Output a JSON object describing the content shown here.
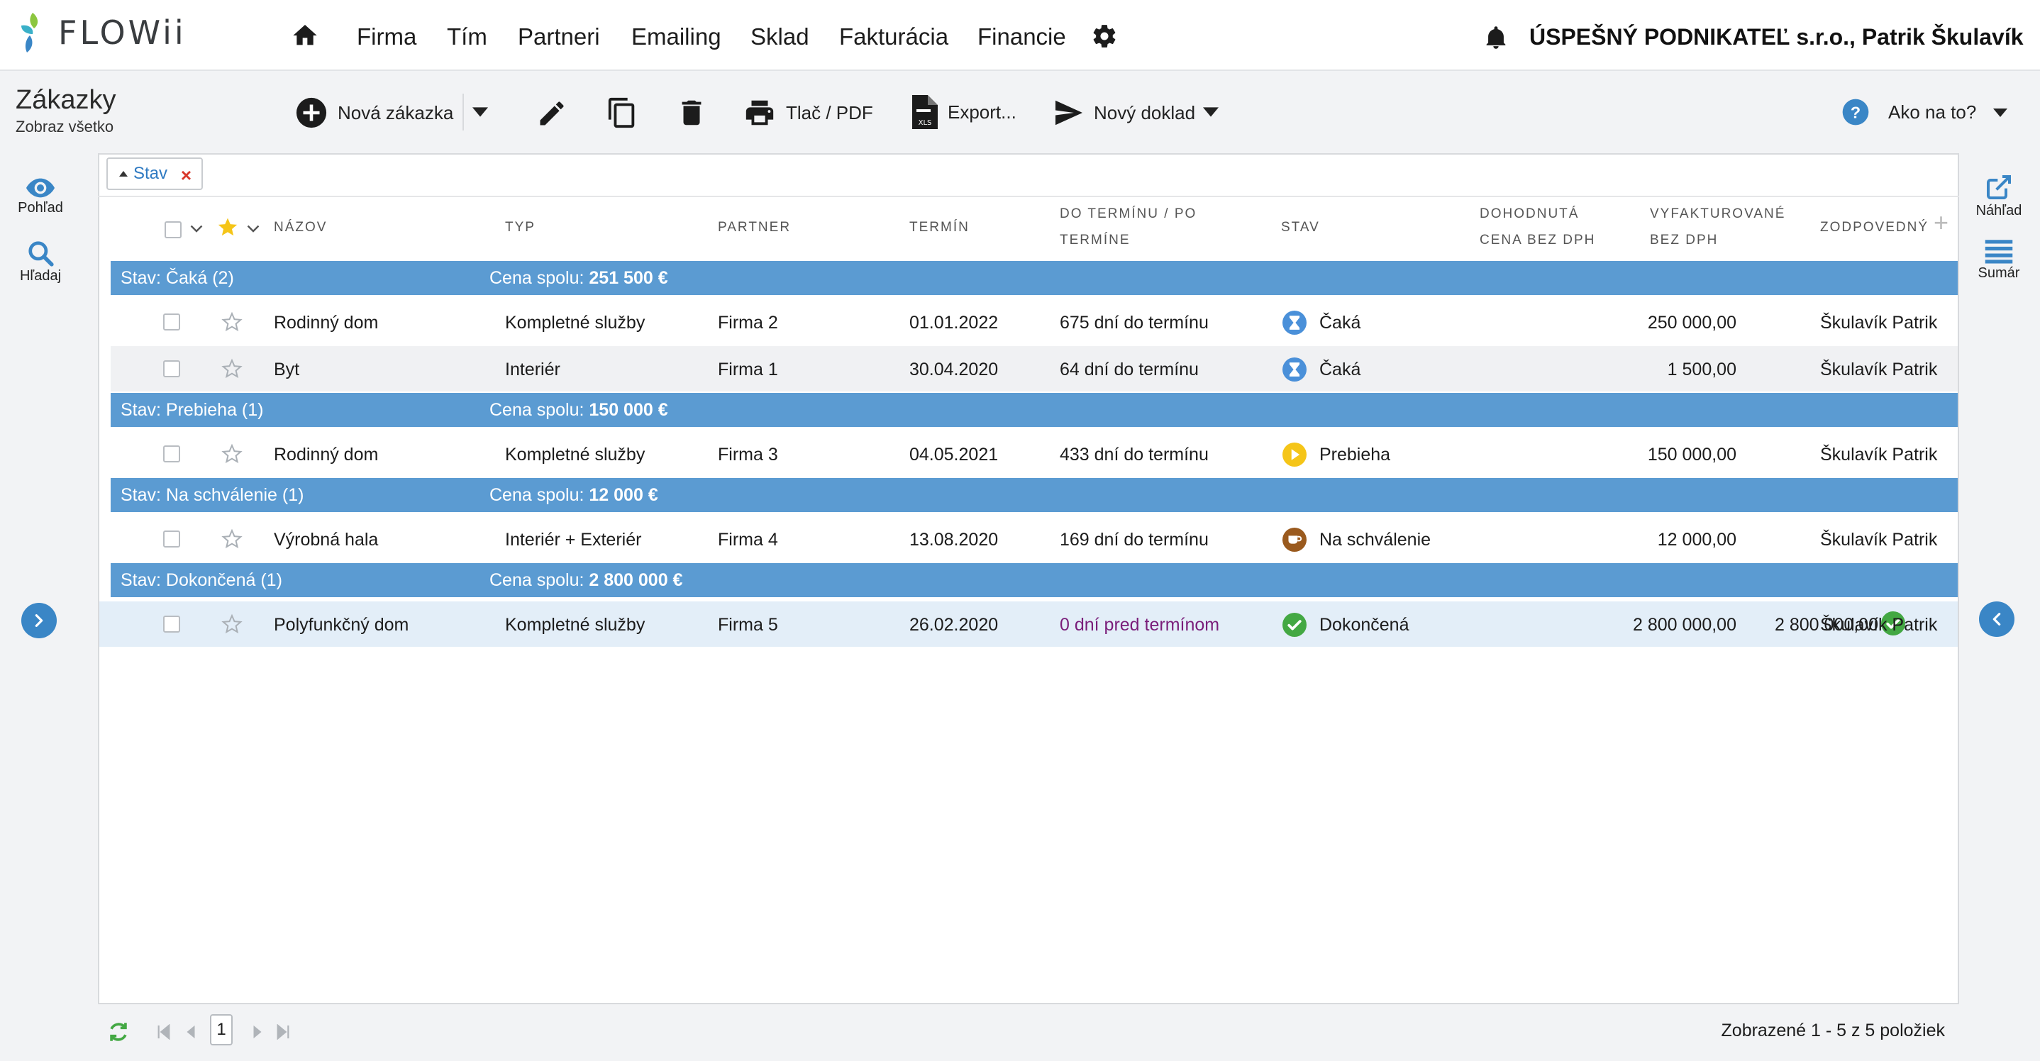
{
  "app": {
    "logo_text": "FLOWii",
    "nav": [
      "Firma",
      "Tím",
      "Partneri",
      "Emailing",
      "Sklad",
      "Fakturácia",
      "Financie"
    ],
    "company": "ÚSPEŠNÝ PODNIKATEĽ s.r.o., Patrik Škulavík"
  },
  "page": {
    "title": "Zákazky",
    "subtitle": "Zobraz všetko"
  },
  "toolbar": {
    "new_order": "Nová zákazka",
    "print": "Tlač / PDF",
    "export": "Export...",
    "new_doc": "Nový doklad",
    "help": "Ako na to?"
  },
  "left_rail": {
    "view": "Pohľad",
    "search": "Hľadaj"
  },
  "right_rail": {
    "preview": "Náhľad",
    "summary": "Sumár"
  },
  "filter": {
    "chip_label": "Stav",
    "remove": "×"
  },
  "columns": {
    "name": "NÁZOV",
    "type": "TYP",
    "partner": "PARTNER",
    "deadline": "TERMÍN",
    "due_line1": "DO TERMÍNU / PO",
    "due_line2": "TERMÍNE",
    "status": "STAV",
    "agreed_line1": "DOHODNUTÁ",
    "agreed_line2": "CENA BEZ DPH",
    "invoiced_line1": "VYFAKTUROVANÉ",
    "invoiced_line2": "BEZ DPH",
    "owner": "ZODPOVEDNÝ",
    "add": "+"
  },
  "groups": [
    {
      "title": "Stav: Čaká (2)",
      "sum_label": "Cena spolu:",
      "sum_value": "251 500 €",
      "rows": [
        {
          "name": "Rodinný dom",
          "type": "Kompletné služby",
          "partner": "Firma 2",
          "deadline": "01.01.2022",
          "due": "675 dní do termínu",
          "status": "Čaká",
          "status_kind": "waiting",
          "agreed": "250 000,00",
          "invoiced": "",
          "owner": "Škulavík Patrik"
        },
        {
          "name": "Byt",
          "type": "Interiér",
          "partner": "Firma 1",
          "deadline": "30.04.2020",
          "due": "64 dní do termínu",
          "status": "Čaká",
          "status_kind": "waiting",
          "agreed": "1 500,00",
          "invoiced": "",
          "owner": "Škulavík Patrik"
        }
      ]
    },
    {
      "title": "Stav: Prebieha (1)",
      "sum_label": "Cena spolu:",
      "sum_value": "150 000 €",
      "rows": [
        {
          "name": "Rodinný dom",
          "type": "Kompletné služby",
          "partner": "Firma 3",
          "deadline": "04.05.2021",
          "due": "433 dní do termínu",
          "status": "Prebieha",
          "status_kind": "running",
          "agreed": "150 000,00",
          "invoiced": "",
          "owner": "Škulavík Patrik"
        }
      ]
    },
    {
      "title": "Stav: Na schválenie (1)",
      "sum_label": "Cena spolu:",
      "sum_value": "12 000 €",
      "rows": [
        {
          "name": "Výrobná hala",
          "type": "Interiér + Exteriér",
          "partner": "Firma 4",
          "deadline": "13.08.2020",
          "due": "169 dní do termínu",
          "status": "Na schválenie",
          "status_kind": "approval",
          "agreed": "12 000,00",
          "invoiced": "",
          "owner": "Škulavík Patrik"
        }
      ]
    },
    {
      "title": "Stav: Dokončená (1)",
      "sum_label": "Cena spolu:",
      "sum_value": "2 800 000 €",
      "rows": [
        {
          "name": "Polyfunkčný dom",
          "type": "Kompletné služby",
          "partner": "Firma 5",
          "deadline": "26.02.2020",
          "due": "0 dní pred termínom",
          "status": "Dokončená",
          "status_kind": "done",
          "agreed": "2 800 000,00",
          "invoiced": "2 800 000,00",
          "owner": "Škulavík Patrik"
        }
      ]
    }
  ],
  "footer": {
    "page": "1",
    "info": "Zobrazené 1 - 5 z 5 položiek"
  },
  "colors": {
    "group_bg": "#5b9bd2",
    "accent_blue": "#3a86c6",
    "waiting": "#4a90d9",
    "running": "#f5c518",
    "approval": "#9a5a1e",
    "done": "#43a843",
    "overdue_text": "#7a1e7a"
  }
}
